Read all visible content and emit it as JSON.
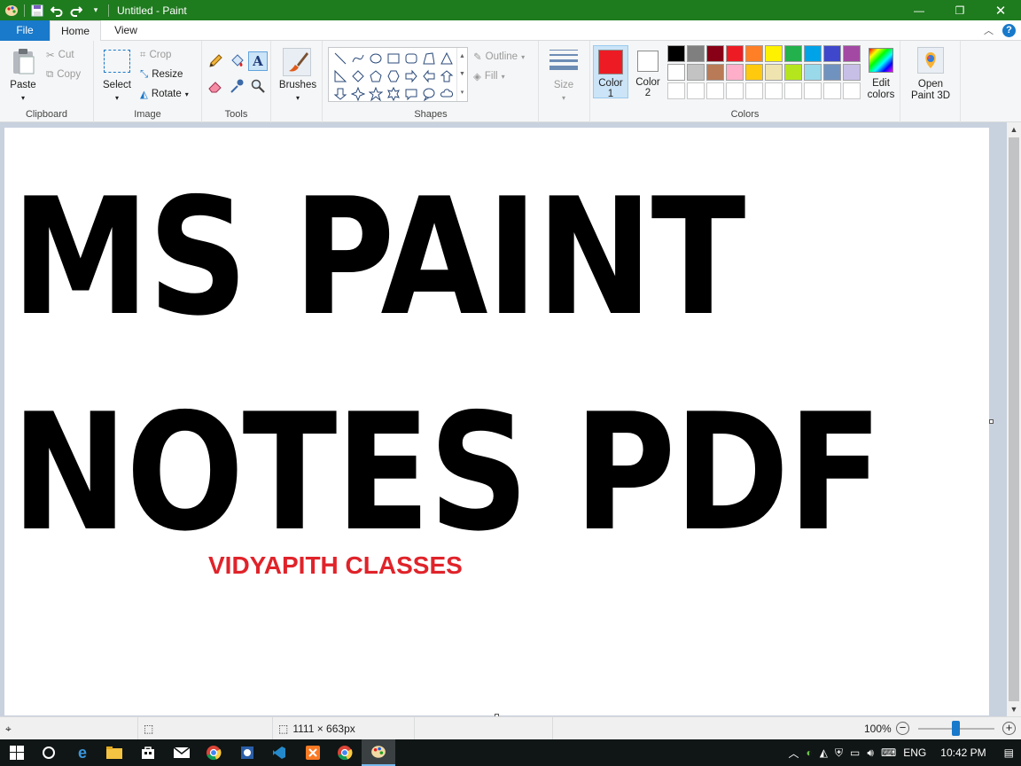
{
  "window": {
    "title": "Untitled - Paint",
    "controls": {
      "minimize": "—",
      "maximize": "❐",
      "close": "✕"
    }
  },
  "tabs": [
    {
      "label": "File"
    },
    {
      "label": "Home"
    },
    {
      "label": "View"
    }
  ],
  "ribbon": {
    "clipboard": {
      "paste": "Paste",
      "cut": "Cut",
      "copy": "Copy",
      "label": "Clipboard"
    },
    "image": {
      "select": "Select",
      "crop": "Crop",
      "resize": "Resize",
      "rotate": "Rotate",
      "label": "Image"
    },
    "tools": {
      "label": "Tools"
    },
    "brushes": {
      "label": "Brushes"
    },
    "shapes": {
      "outline": "Outline",
      "fill": "Fill",
      "label": "Shapes"
    },
    "size": {
      "label": "Size"
    },
    "colors": {
      "color1_line1": "Color",
      "color1_line2": "1",
      "color2_line1": "Color",
      "color2_line2": "2",
      "edit_line1": "Edit",
      "edit_line2": "colors",
      "label": "Colors",
      "color1": "#ed1c24",
      "color2": "#ffffff",
      "palette": [
        "#000000",
        "#7f7f7f",
        "#880015",
        "#ed1c24",
        "#ff7f27",
        "#fff200",
        "#22b14c",
        "#00a2e8",
        "#3f48cc",
        "#a349a4",
        "#ffffff",
        "#c3c3c3",
        "#b97a57",
        "#ffaec9",
        "#ffc90e",
        "#efe4b0",
        "#b5e61d",
        "#99d9ea",
        "#7092be",
        "#c8bfe7",
        "#ffffff",
        "#ffffff",
        "#ffffff",
        "#ffffff",
        "#ffffff",
        "#ffffff",
        "#ffffff",
        "#ffffff",
        "#ffffff",
        "#ffffff"
      ]
    },
    "paint3d": {
      "line1": "Open",
      "line2": "Paint 3D"
    }
  },
  "canvas": {
    "line1": "MS PAINT",
    "line2": "NOTES PDF",
    "line3": "VIDYAPITH CLASSES",
    "line3_color": "#e0232a"
  },
  "status": {
    "image_size": "1111 × 663px",
    "zoom": "100%",
    "zoom_level": 100
  },
  "taskbar": {
    "language": "ENG",
    "time": "10:42 PM"
  }
}
